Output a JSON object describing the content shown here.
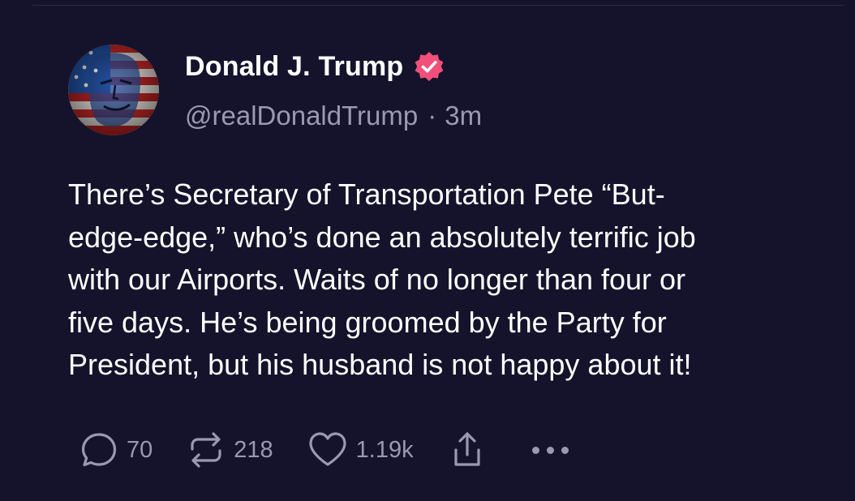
{
  "post": {
    "author": {
      "display_name": "Donald J. Trump",
      "handle": "@realDonaldTrump",
      "verified": true,
      "separator": "·",
      "time": "3m"
    },
    "body_lines": [
      "There’s Secretary of Transportation Pete “But-",
      "edge-edge,” who’s done an absolutely terrific job",
      "with our Airports. Waits of no longer than four or",
      "five days. He’s being groomed by the Party for",
      "President, but his husband is not happy about it!"
    ],
    "actions": {
      "reply_count": "70",
      "repost_count": "218",
      "like_count": "1.19k"
    }
  },
  "colors": {
    "background": "#15132b",
    "text": "#ffffff",
    "muted": "#9b98b2",
    "verified_badge": "#f0507a"
  },
  "icons": [
    "reply-icon",
    "repost-icon",
    "like-icon",
    "share-icon",
    "more-icon",
    "verified-badge-icon"
  ]
}
